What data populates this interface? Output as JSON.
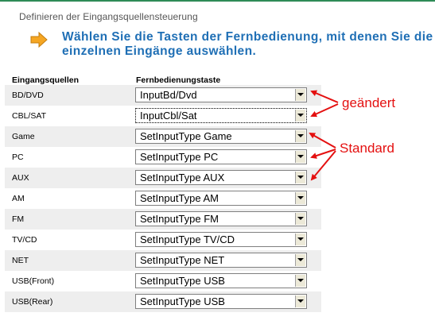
{
  "section_title": "Definieren der Eingangsquellensteuerung",
  "instruction": "Wählen Sie die Tasten der Fernbedienung, mit denen Sie die einzelnen Eingänge auswählen.",
  "headers": {
    "source": "Eingangsquellen",
    "key": "Fernbedienungstaste"
  },
  "rows": [
    {
      "source": "BD/DVD",
      "key": "InputBd/Dvd"
    },
    {
      "source": "CBL/SAT",
      "key": "InputCbl/Sat"
    },
    {
      "source": "Game",
      "key": "SetInputType Game"
    },
    {
      "source": "PC",
      "key": "SetInputType PC"
    },
    {
      "source": "AUX",
      "key": "SetInputType AUX"
    },
    {
      "source": "AM",
      "key": "SetInputType AM"
    },
    {
      "source": "FM",
      "key": "SetInputType FM"
    },
    {
      "source": "TV/CD",
      "key": "SetInputType TV/CD"
    },
    {
      "source": "NET",
      "key": "SetInputType NET"
    },
    {
      "source": "USB(Front)",
      "key": "SetInputType USB"
    },
    {
      "source": "USB(Rear)",
      "key": "SetInputType USB"
    }
  ],
  "annotations": {
    "changed": "geändert",
    "standard": "Standard"
  },
  "colors": {
    "instruction_text": "#1f6fb5",
    "annotation_red": "#e41010",
    "arrow_orange": "#f5a623"
  }
}
